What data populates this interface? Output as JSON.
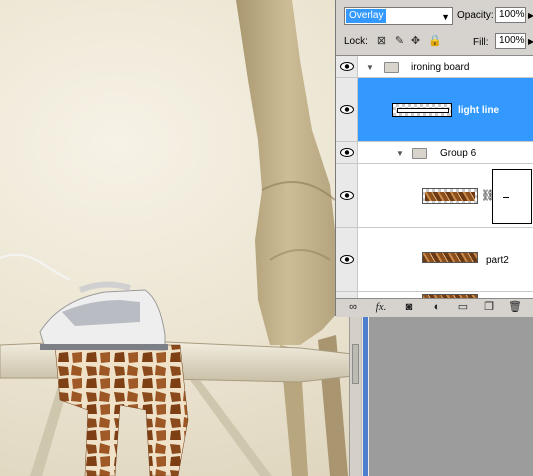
{
  "layers_panel": {
    "blend_mode": "Overlay",
    "opacity_label": "Opacity:",
    "opacity_value": "100%",
    "lock_label": "Lock:",
    "fill_label": "Fill:",
    "fill_value": "100%",
    "selection_color": "#3399ff",
    "layers": [
      {
        "name": "ironing board",
        "type": "group",
        "visible": true,
        "selected": false
      },
      {
        "name": "light line",
        "type": "layer",
        "visible": true,
        "selected": true
      },
      {
        "name": "Group 6",
        "type": "group",
        "visible": true,
        "selected": false
      },
      {
        "name": "",
        "type": "layer-with-mask",
        "visible": true,
        "selected": false
      },
      {
        "name": "part2",
        "type": "layer",
        "visible": true,
        "selected": false
      },
      {
        "name": "",
        "type": "layer",
        "visible": true,
        "selected": false
      }
    ],
    "bottom_icons": [
      "link-icon",
      "fx-icon",
      "mask-icon",
      "adjustment-icon",
      "new-group-icon",
      "new-layer-icon",
      "trash-icon"
    ]
  },
  "canvas": {
    "subject": "giraffe ironing illustration"
  }
}
